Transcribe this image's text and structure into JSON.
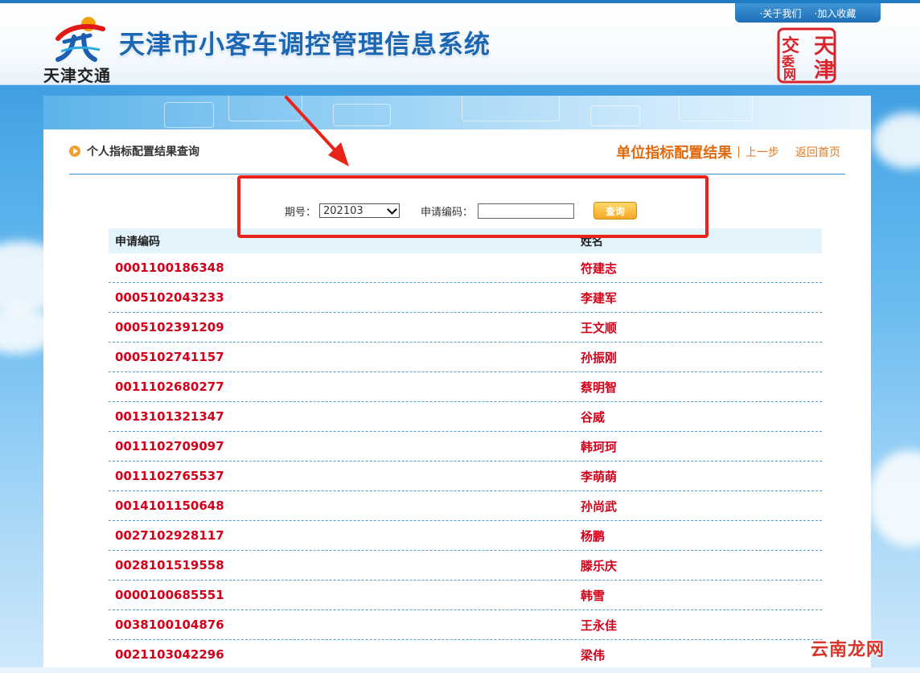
{
  "header": {
    "logo_text": "天津交通",
    "system_title": "天津市小客车调控管理信息系统",
    "top_links": [
      "·关于我们",
      "·加入收藏"
    ],
    "seal_text": "天津交委网"
  },
  "page": {
    "breadcrumb": "个人指标配置结果查询",
    "right_title": "单位指标配置结果",
    "separator": "|",
    "back_link": "上一步",
    "home_link": "返回首页"
  },
  "query": {
    "period_label": "期号：",
    "period_value": "202103",
    "code_label": "申请编码：",
    "code_value": "",
    "search_label": "查询"
  },
  "table": {
    "headers": [
      "申请编码",
      "姓名"
    ],
    "rows": [
      [
        "0001100186348",
        "符建志"
      ],
      [
        "0005102043233",
        "李建军"
      ],
      [
        "0005102391209",
        "王文顺"
      ],
      [
        "0005102741157",
        "孙振刚"
      ],
      [
        "0011102680277",
        "蔡明智"
      ],
      [
        "0013101321347",
        "谷威"
      ],
      [
        "0011102709097",
        "韩珂珂"
      ],
      [
        "0011102765537",
        "李萌萌"
      ],
      [
        "0014101150648",
        "孙尚武"
      ],
      [
        "0027102928117",
        "杨鹏"
      ],
      [
        "0028101519558",
        "滕乐庆"
      ],
      [
        "0000100685551",
        "韩雪"
      ],
      [
        "0038100104876",
        "王永佳"
      ],
      [
        "0021103042296",
        "梁伟"
      ]
    ]
  },
  "watermark": "云南龙网",
  "colors": {
    "accent_blue": "#1b67b3",
    "data_red": "#d4001a",
    "orange": "#e06a10",
    "annotation_red": "#e8231a"
  }
}
